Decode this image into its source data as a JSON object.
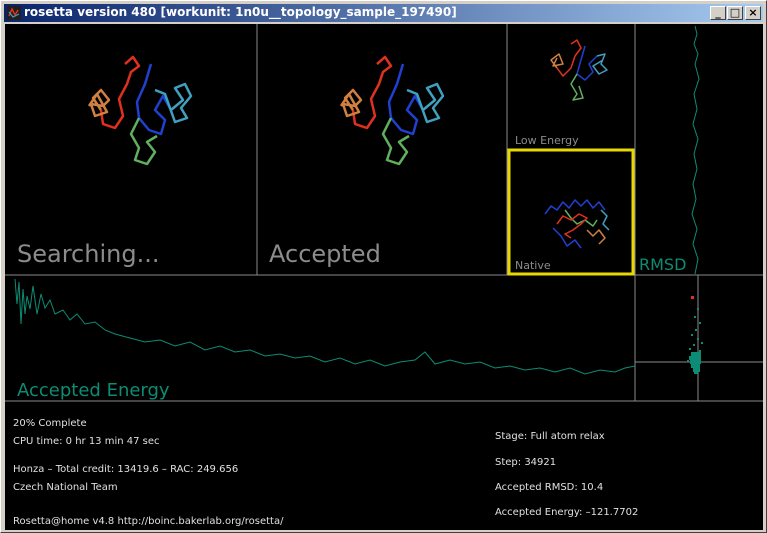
{
  "window": {
    "title": "rosetta version 480 [workunit: 1n0u__topology_sample_197490]",
    "minimize_glyph": "_",
    "maximize_glyph": "□",
    "close_glyph": "×"
  },
  "panels": {
    "searching_label": "Searching...",
    "accepted_label": "Accepted",
    "low_energy_label": "Low  Energy",
    "native_label": "Native",
    "rmsd_label": "RMSD",
    "accepted_energy_label": "Accepted  Energy"
  },
  "status": {
    "progress_text": "20%  Complete",
    "cpu_time": "CPU  time:  0  hr  13  min  47  sec",
    "user_credit": "Honza  –  Total  credit:  13419.6  –  RAC:  249.656",
    "team": "Czech  National  Team",
    "stage": "Stage:  Full  atom  relax",
    "step": "Step:  34921",
    "accepted_rmsd": "Accepted  RMSD:   10.4",
    "accepted_energy": "Accepted  Energy:  –121.7702",
    "footer": "Rosetta@home   v4.8   http://boinc.bakerlab.org/rosetta/"
  },
  "colors": {
    "trace": "#0c8c74",
    "grid": "#8a8a8a",
    "highlight": "#e8d800",
    "protein": [
      "#e03020",
      "#d08040",
      "#2040d0",
      "#40a0c0",
      "#60b060"
    ]
  }
}
